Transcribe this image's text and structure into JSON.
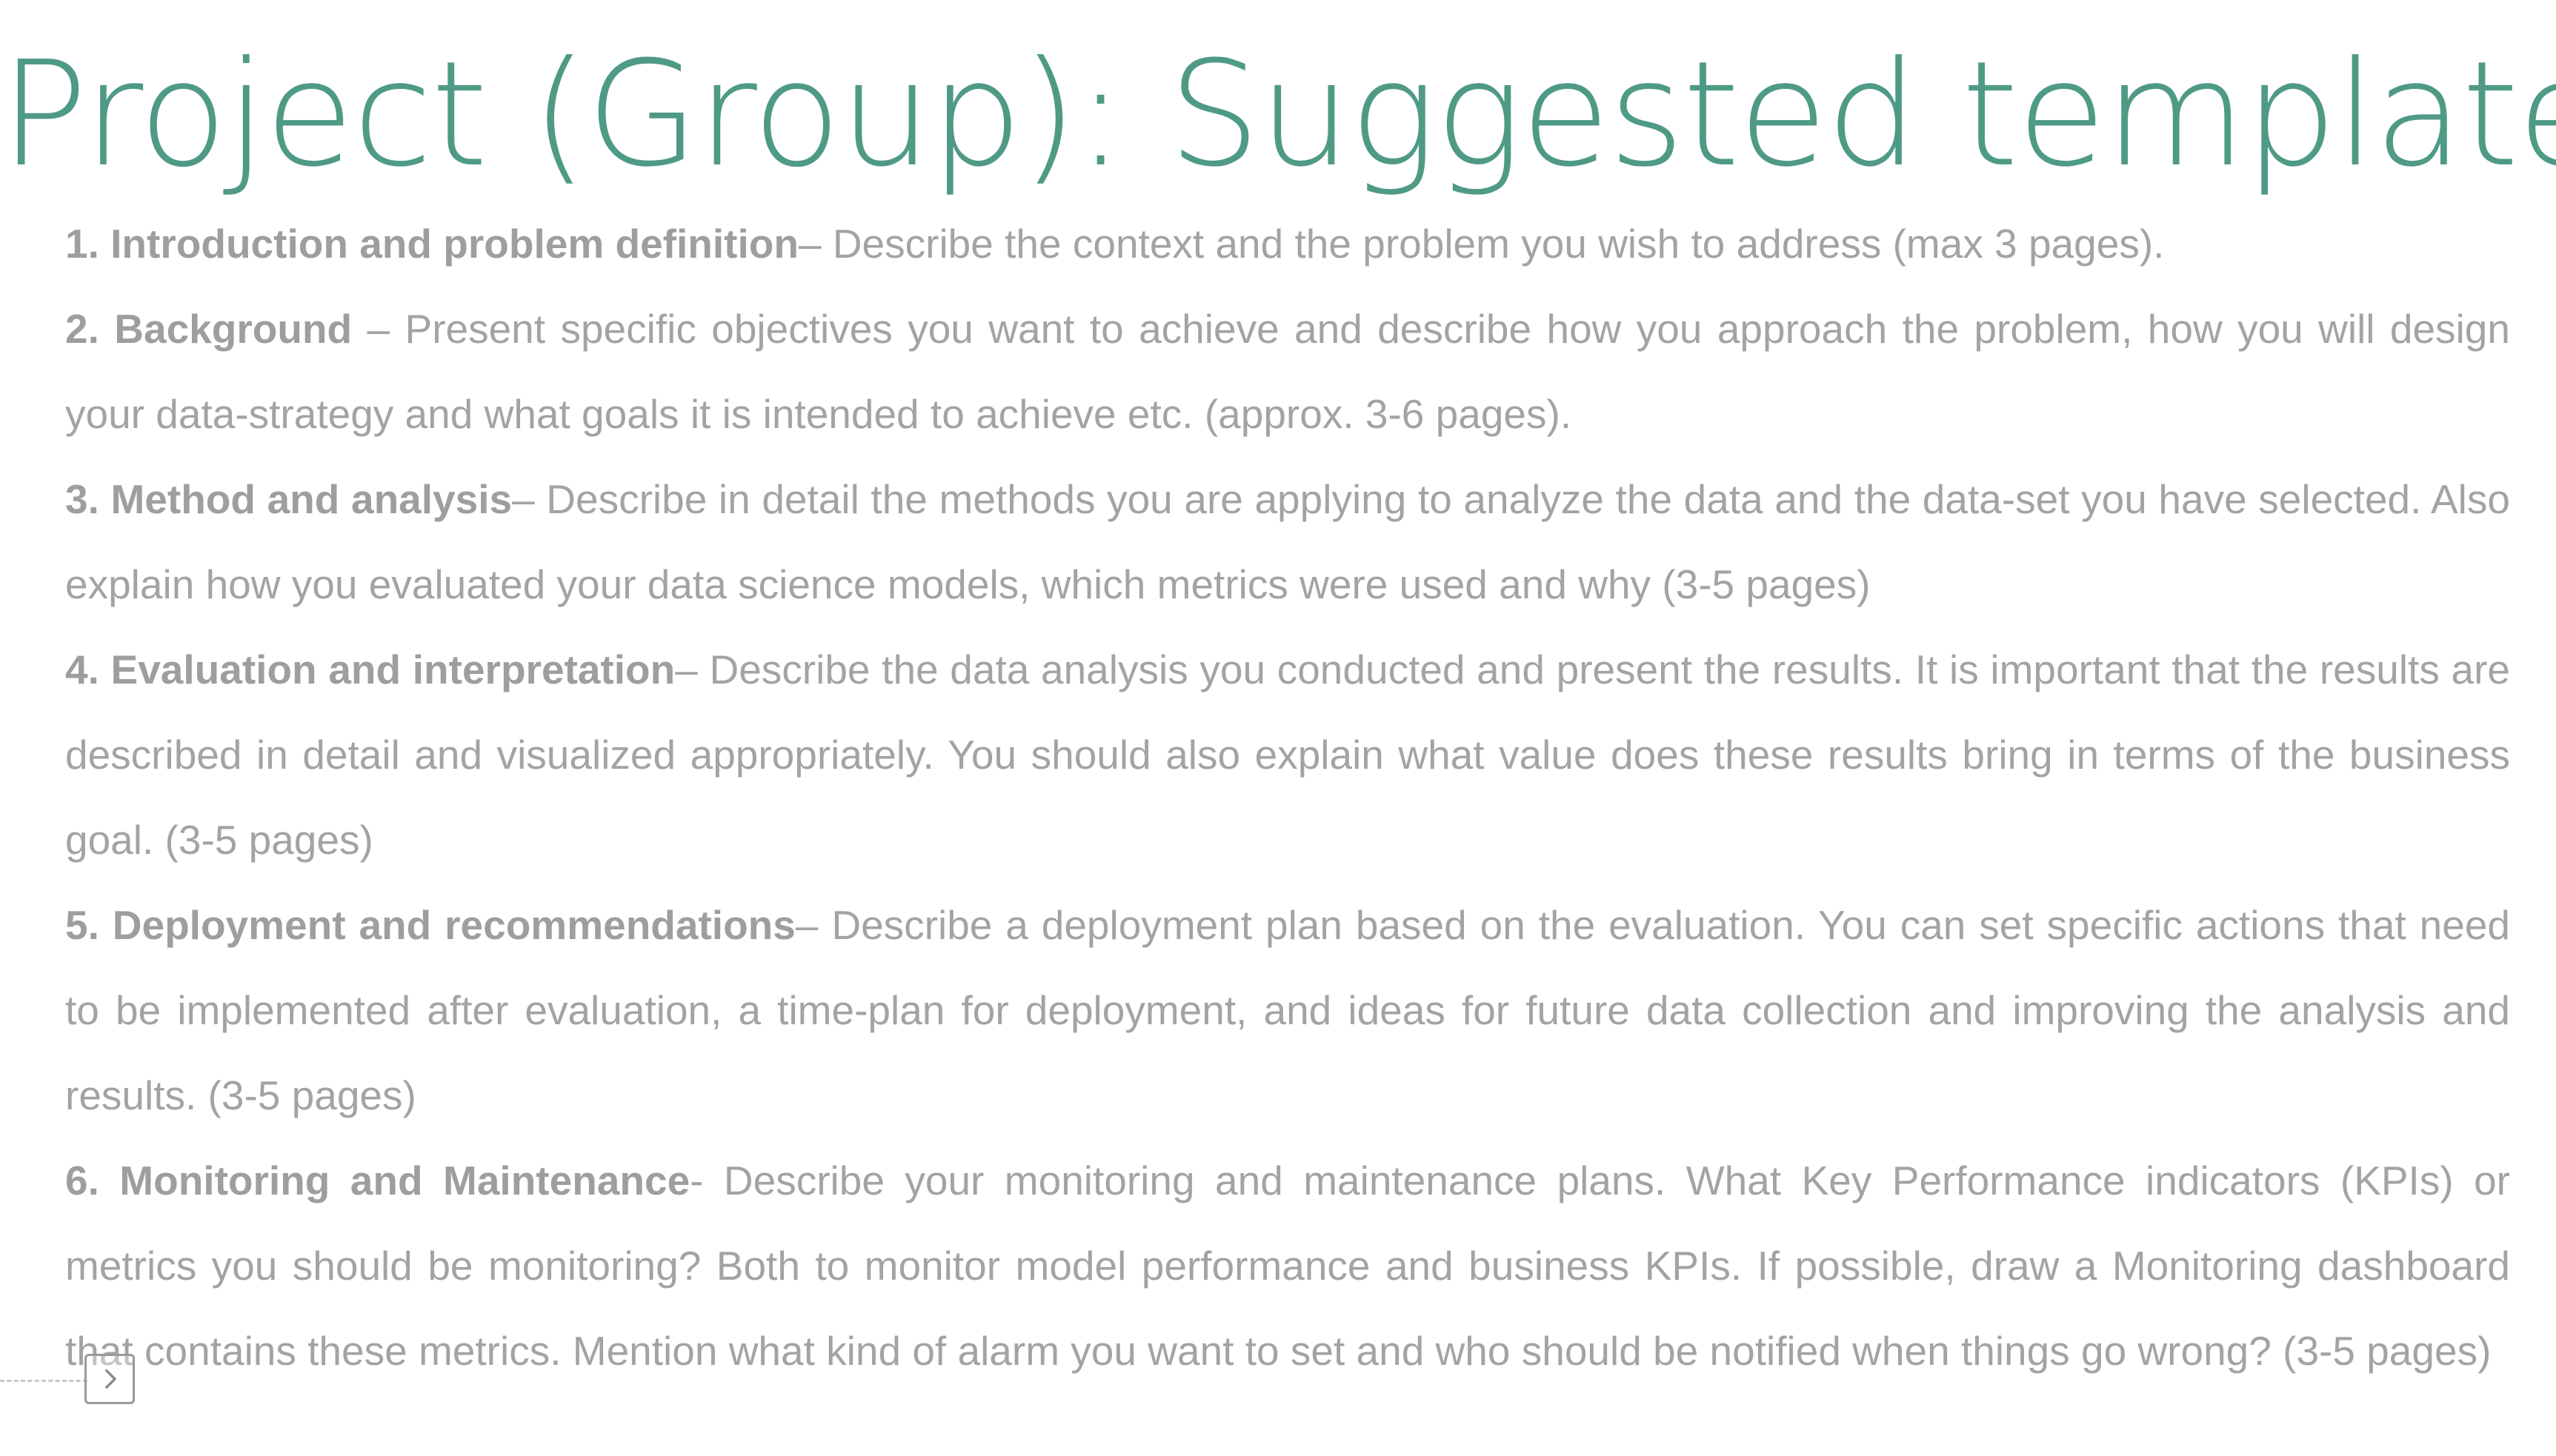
{
  "slide": {
    "title": "Project (Group): Suggested template",
    "sections": [
      {
        "heading": "1. Introduction and problem definition",
        "body": "– Describe the context and the problem you wish to address (max 3 pages)."
      },
      {
        "heading": "2. Background",
        "body": " – Present specific objectives you want to achieve and describe how you approach the problem, how you will design your data-strategy and what goals it is intended to achieve etc. (approx. 3-6 pages)."
      },
      {
        "heading": "3. Method and analysis",
        "body": "– Describe in detail the methods you are applying to analyze the data and the data-set you have selected. Also explain how you evaluated your data science models, which metrics were used and why (3-5 pages)"
      },
      {
        "heading": "4. Evaluation and interpretation",
        "body": "– Describe the data analysis you conducted and present the results. It is important that the results are described in detail and visualized appropriately. You should also explain what value does these results bring in terms of the business goal. (3-5 pages)"
      },
      {
        "heading": "5. Deployment and recommendations",
        "body": "– Describe a deployment plan based on the evaluation. You can set specific actions that need to be implemented after evaluation, a time-plan for deployment, and ideas for future data collection and improving the analysis and results. (3-5 pages)"
      },
      {
        "heading": "6. Monitoring and Maintenance",
        "body": "- Describe your monitoring and maintenance plans. What Key Performance indicators (KPIs) or metrics you should be monitoring? Both to monitor model performance and business KPIs. If possible, draw a Monitoring dashboard that contains these metrics. Mention what kind of alarm you want to set and who should be notified when things go wrong? (3-5 pages)"
      }
    ]
  },
  "controls": {
    "next_button_icon": "chevron-right-icon"
  },
  "colors": {
    "title": "#4f9a86",
    "body_text": "#a3a3a3",
    "background": "#ffffff"
  }
}
